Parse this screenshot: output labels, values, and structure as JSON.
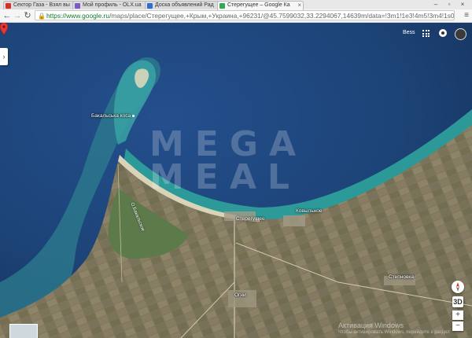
{
  "browser": {
    "tabs": [
      {
        "title": "Сектор Газа - Взял вы",
        "icon_color": "#d93025",
        "active": false
      },
      {
        "title": "Мой профиль - OLX.ua",
        "icon_color": "#7a5cc7",
        "active": false
      },
      {
        "title": "Доска объявлений Рад",
        "icon_color": "#2c6fd1",
        "active": false
      },
      {
        "title": "Стерегущее – Google Ка",
        "icon_color": "#34a853",
        "active": true
      }
    ],
    "close_glyph": "×",
    "window_buttons": {
      "minimize": "–",
      "maximize": "▫",
      "close": "×"
    },
    "back_icon": "←",
    "forward_icon": "→",
    "reload_icon": "↻",
    "url_base": "https://www.google.ru",
    "url_rest": "/maps/place/Стерегущее,+Крым,+Украина,+96231/@45.7599032,33.2294067,14639m/data=!3m1!1e3!4m5!3m4!1s0x40c1afe9fbd60",
    "menu_icon": "≡"
  },
  "map": {
    "side_toggle": "›",
    "user_name": "Bess",
    "places": {
      "spit": "Бакальська коса",
      "village": "Стерегущее",
      "east_village": "Ковыльное",
      "south_village": "Огни",
      "far_village": "Степновка"
    },
    "road_label": "О.Бакальское",
    "watermark": "MEGA\nMEAL",
    "compass_label": "N",
    "button_3d": "3D",
    "zoom_in": "+",
    "zoom_out": "−",
    "pin_color": "#e53935",
    "windows_activation": "Активация Windows",
    "windows_activation_sub": "Чтобы активировать Windows, перейдите в раздел"
  }
}
